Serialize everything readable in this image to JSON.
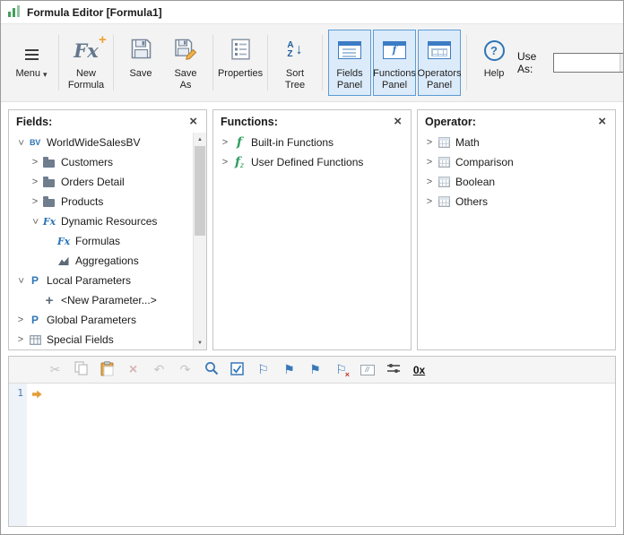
{
  "window": {
    "title": "Formula Editor [Formula1]"
  },
  "toolbar": {
    "menu_label": "Menu",
    "new_formula": "New Formula",
    "save": "Save",
    "save_as": "Save As",
    "properties": "Properties",
    "sort_tree": "Sort Tree",
    "fields_panel": "Fields Panel",
    "functions_panel": "Functions Panel",
    "operators_panel": "Operators Panel",
    "help": "Help",
    "use_as_label": "Use As:",
    "use_as_value": ""
  },
  "panels": {
    "fields": {
      "title": "Fields:",
      "items": [
        {
          "label": "WorldWideSalesBV",
          "icon": "business-view",
          "state": "expanded"
        },
        {
          "label": "Customers",
          "icon": "folder",
          "state": "collapsed"
        },
        {
          "label": "Orders Detail",
          "icon": "folder",
          "state": "collapsed"
        },
        {
          "label": "Products",
          "icon": "folder",
          "state": "collapsed"
        },
        {
          "label": "Dynamic Resources",
          "icon": "fx",
          "state": "expanded"
        },
        {
          "label": "Formulas",
          "icon": "fx",
          "state": "leaf"
        },
        {
          "label": "Aggregations",
          "icon": "chart",
          "state": "leaf"
        },
        {
          "label": "Local Parameters",
          "icon": "parameter",
          "state": "expanded"
        },
        {
          "label": "<New Parameter...>",
          "icon": "plus",
          "state": "leaf"
        },
        {
          "label": "Global Parameters",
          "icon": "parameter",
          "state": "collapsed"
        },
        {
          "label": "Special Fields",
          "icon": "grid",
          "state": "collapsed"
        }
      ]
    },
    "functions": {
      "title": "Functions:",
      "items": [
        {
          "label": "Built-in Functions",
          "icon": "function-f",
          "state": "collapsed"
        },
        {
          "label": "User Defined Functions",
          "icon": "function-fz",
          "state": "collapsed"
        }
      ]
    },
    "operator": {
      "title": "Operator:",
      "items": [
        {
          "label": "Math",
          "icon": "operator-grid",
          "state": "collapsed"
        },
        {
          "label": "Comparison",
          "icon": "operator-grid",
          "state": "collapsed"
        },
        {
          "label": "Boolean",
          "icon": "operator-grid",
          "state": "collapsed"
        },
        {
          "label": "Others",
          "icon": "operator-grid",
          "state": "collapsed"
        }
      ]
    }
  },
  "editor": {
    "line_number": "1",
    "hex_label": "0x",
    "content": ""
  },
  "colors": {
    "accent_blue": "#2e75b6",
    "active_button_bg": "#dcebfa",
    "active_button_border": "#5b9bd5",
    "current_line_arrow": "#e59d35",
    "builtin_function_green": "#2f9e5f",
    "titlebar_icon_green": "#43a05c"
  }
}
